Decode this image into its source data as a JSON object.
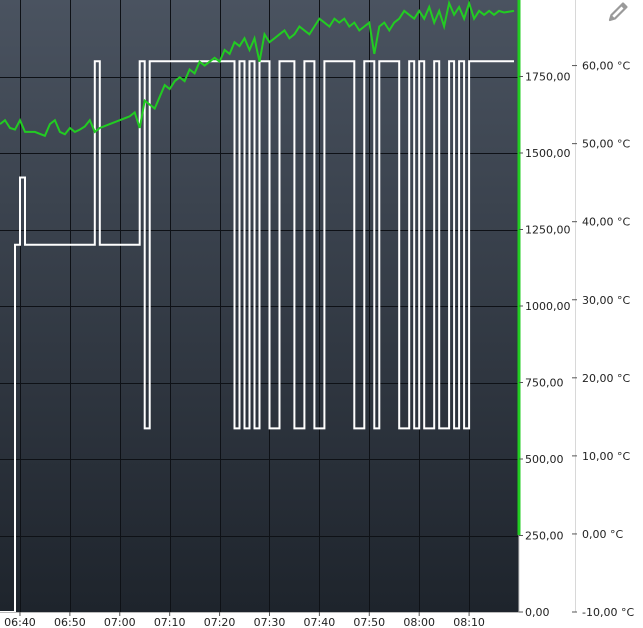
{
  "colors": {
    "plot_top": "#4a5360",
    "plot_bottom": "#1e242c",
    "grid": "#0e1116",
    "series_power": "#ffffff",
    "series_temperature": "#22cc22",
    "axis_accent": "#22cc22",
    "tick_text": "#222222",
    "icon": "#9a9a9a"
  },
  "icons": {
    "edit": "pencil-icon"
  },
  "chart_data": {
    "type": "line",
    "grid": true,
    "x_axis": {
      "range": [
        "06:36",
        "08:20"
      ],
      "tick_labels": [
        "06:40",
        "06:50",
        "07:00",
        "07:10",
        "07:20",
        "07:30",
        "07:40",
        "07:50",
        "08:00",
        "08:10"
      ]
    },
    "y_axis_left": {
      "range": [
        0,
        2000
      ],
      "tick_values": [
        0,
        250,
        500,
        750,
        1000,
        1250,
        1500,
        1750
      ],
      "tick_labels": [
        "0,00",
        "250,00",
        "500,00",
        "750,00",
        "1000,00",
        "1250,00",
        "1500,00",
        "1750,00"
      ]
    },
    "y_axis_right": {
      "range": [
        -10,
        68.4
      ],
      "tick_values": [
        -10,
        0,
        10,
        20,
        30,
        40,
        50,
        60
      ],
      "tick_labels": [
        "-10,00 °C",
        "0,00 °C",
        "10,00 °C",
        "20,00 °C",
        "30,00 °C",
        "40,00 °C",
        "50,00 °C",
        "60,00 °C"
      ]
    },
    "series": [
      {
        "axis": "left",
        "style": "step",
        "points": [
          [
            "06:36",
            0
          ],
          [
            "06:39",
            0
          ],
          [
            "06:39",
            1200
          ],
          [
            "06:40",
            1200
          ],
          [
            "06:40",
            1420
          ],
          [
            "06:41",
            1420
          ],
          [
            "06:41",
            1200
          ],
          [
            "06:55",
            1200
          ],
          [
            "06:55",
            1800
          ],
          [
            "06:56",
            1800
          ],
          [
            "06:56",
            1200
          ],
          [
            "07:04",
            1200
          ],
          [
            "07:04",
            1800
          ],
          [
            "07:05",
            1800
          ],
          [
            "07:05",
            600
          ],
          [
            "07:06",
            600
          ],
          [
            "07:06",
            1800
          ],
          [
            "07:23",
            1800
          ],
          [
            "07:23",
            600
          ],
          [
            "07:24",
            600
          ],
          [
            "07:24",
            1800
          ],
          [
            "07:25",
            1800
          ],
          [
            "07:25",
            600
          ],
          [
            "07:26",
            600
          ],
          [
            "07:26",
            1800
          ],
          [
            "07:27",
            1800
          ],
          [
            "07:27",
            600
          ],
          [
            "07:28",
            600
          ],
          [
            "07:28",
            1800
          ],
          [
            "07:30",
            1800
          ],
          [
            "07:30",
            600
          ],
          [
            "07:32",
            600
          ],
          [
            "07:32",
            1800
          ],
          [
            "07:35",
            1800
          ],
          [
            "07:35",
            600
          ],
          [
            "07:37",
            600
          ],
          [
            "07:37",
            1800
          ],
          [
            "07:39",
            1800
          ],
          [
            "07:39",
            600
          ],
          [
            "07:41",
            600
          ],
          [
            "07:41",
            1800
          ],
          [
            "07:47",
            1800
          ],
          [
            "07:47",
            600
          ],
          [
            "07:49",
            600
          ],
          [
            "07:49",
            1800
          ],
          [
            "07:51",
            1800
          ],
          [
            "07:51",
            600
          ],
          [
            "07:52",
            600
          ],
          [
            "07:52",
            1800
          ],
          [
            "07:56",
            1800
          ],
          [
            "07:56",
            600
          ],
          [
            "07:58",
            600
          ],
          [
            "07:58",
            1800
          ],
          [
            "07:59",
            1800
          ],
          [
            "07:59",
            600
          ],
          [
            "08:00",
            600
          ],
          [
            "08:00",
            1800
          ],
          [
            "08:01",
            1800
          ],
          [
            "08:01",
            600
          ],
          [
            "08:03",
            600
          ],
          [
            "08:03",
            1800
          ],
          [
            "08:04",
            1800
          ],
          [
            "08:04",
            600
          ],
          [
            "08:06",
            600
          ],
          [
            "08:06",
            1800
          ],
          [
            "08:07",
            1800
          ],
          [
            "08:07",
            600
          ],
          [
            "08:08",
            600
          ],
          [
            "08:08",
            1800
          ],
          [
            "08:09",
            1800
          ],
          [
            "08:09",
            600
          ],
          [
            "08:10",
            600
          ],
          [
            "08:10",
            1800
          ],
          [
            "08:19",
            1800
          ]
        ]
      },
      {
        "axis": "right",
        "style": "line",
        "points": [
          [
            "06:36",
            52.5
          ],
          [
            "06:37",
            53.0
          ],
          [
            "06:38",
            52.0
          ],
          [
            "06:39",
            51.8
          ],
          [
            "06:40",
            53.0
          ],
          [
            "06:41",
            51.5
          ],
          [
            "06:43",
            51.5
          ],
          [
            "06:45",
            51.0
          ],
          [
            "06:46",
            52.5
          ],
          [
            "06:47",
            53.0
          ],
          [
            "06:48",
            51.5
          ],
          [
            "06:49",
            51.2
          ],
          [
            "06:50",
            52.0
          ],
          [
            "06:51",
            51.5
          ],
          [
            "06:52",
            51.8
          ],
          [
            "06:53",
            52.2
          ],
          [
            "06:54",
            53.0
          ],
          [
            "06:55",
            51.5
          ],
          [
            "06:56",
            52.0
          ],
          [
            "06:58",
            52.5
          ],
          [
            "07:00",
            53.0
          ],
          [
            "07:02",
            53.5
          ],
          [
            "07:03",
            54.0
          ],
          [
            "07:04",
            52.0
          ],
          [
            "07:05",
            55.5
          ],
          [
            "07:06",
            55.0
          ],
          [
            "07:07",
            54.5
          ],
          [
            "07:08",
            56.0
          ],
          [
            "07:09",
            57.5
          ],
          [
            "07:10",
            57.0
          ],
          [
            "07:11",
            58.0
          ],
          [
            "07:12",
            58.5
          ],
          [
            "07:13",
            58.0
          ],
          [
            "07:14",
            59.5
          ],
          [
            "07:15",
            59.0
          ],
          [
            "07:16",
            60.5
          ],
          [
            "07:17",
            60.0
          ],
          [
            "07:18",
            60.5
          ],
          [
            "07:19",
            61.0
          ],
          [
            "07:20",
            60.5
          ],
          [
            "07:21",
            62.0
          ],
          [
            "07:22",
            61.5
          ],
          [
            "07:23",
            63.0
          ],
          [
            "07:24",
            62.5
          ],
          [
            "07:25",
            63.5
          ],
          [
            "07:26",
            62.0
          ],
          [
            "07:27",
            63.5
          ],
          [
            "07:28",
            60.5
          ],
          [
            "07:29",
            64.0
          ],
          [
            "07:30",
            63.0
          ],
          [
            "07:31",
            63.5
          ],
          [
            "07:32",
            64.0
          ],
          [
            "07:33",
            64.5
          ],
          [
            "07:34",
            63.5
          ],
          [
            "07:35",
            64.0
          ],
          [
            "07:36",
            65.0
          ],
          [
            "07:37",
            64.5
          ],
          [
            "07:38",
            64.0
          ],
          [
            "07:39",
            65.0
          ],
          [
            "07:40",
            66.0
          ],
          [
            "07:41",
            65.5
          ],
          [
            "07:42",
            65.0
          ],
          [
            "07:43",
            66.0
          ],
          [
            "07:44",
            65.5
          ],
          [
            "07:45",
            66.0
          ],
          [
            "07:46",
            65.0
          ],
          [
            "07:47",
            65.5
          ],
          [
            "07:48",
            64.5
          ],
          [
            "07:49",
            65.0
          ],
          [
            "07:50",
            65.5
          ],
          [
            "07:51",
            61.5
          ],
          [
            "07:52",
            65.0
          ],
          [
            "07:53",
            65.5
          ],
          [
            "07:54",
            64.5
          ],
          [
            "07:55",
            65.5
          ],
          [
            "07:56",
            66.0
          ],
          [
            "07:57",
            67.0
          ],
          [
            "07:58",
            66.5
          ],
          [
            "07:59",
            66.0
          ],
          [
            "08:00",
            67.0
          ],
          [
            "08:01",
            66.0
          ],
          [
            "08:02",
            67.5
          ],
          [
            "08:03",
            65.5
          ],
          [
            "08:04",
            67.0
          ],
          [
            "08:05",
            65.0
          ],
          [
            "08:06",
            68.0
          ],
          [
            "08:07",
            66.5
          ],
          [
            "08:08",
            67.5
          ],
          [
            "08:09",
            66.0
          ],
          [
            "08:10",
            68.0
          ],
          [
            "08:11",
            66.0
          ],
          [
            "08:12",
            67.0
          ],
          [
            "08:13",
            66.5
          ],
          [
            "08:14",
            67.0
          ],
          [
            "08:15",
            66.5
          ],
          [
            "08:16",
            67.0
          ],
          [
            "08:17",
            66.8
          ],
          [
            "08:19",
            67.0
          ]
        ]
      }
    ]
  }
}
